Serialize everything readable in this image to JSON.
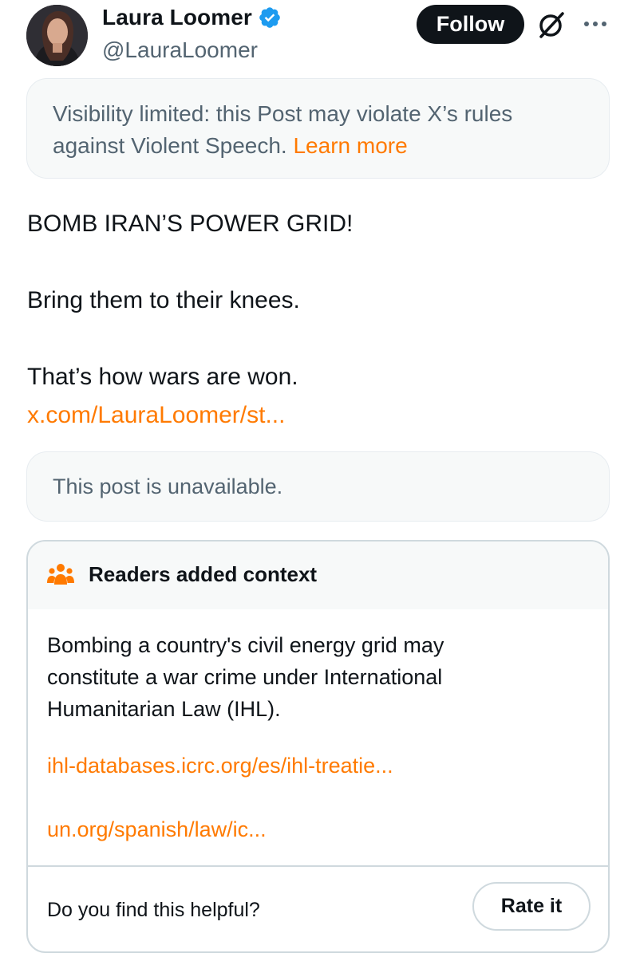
{
  "author": {
    "name": "Laura Loomer",
    "handle": "@LauraLoomer",
    "verified": true,
    "verified_color": "#1d9bf0"
  },
  "actions": {
    "follow_label": "Follow",
    "grok_icon": "grok-icon",
    "more_icon": "more-icon"
  },
  "visibility_notice": {
    "text_line1": "Visibility limited: this Post may violate X’s rules",
    "text_line2": "against Violent Speech.",
    "link_label": "Learn more"
  },
  "tweet": {
    "line1": "BOMB IRAN’S POWER GRID!",
    "line2": "Bring them to their knees.",
    "line3": "That’s how wars are won.",
    "link": "x.com/LauraLoomer/st..."
  },
  "quoted_post": {
    "text": "This post is unavailable."
  },
  "community_note": {
    "title": "Readers added context",
    "icon": "people-icon",
    "body_line1": "Bombing a country's civil energy grid may",
    "body_line2": "constitute a war crime under International",
    "body_line3": "Humanitarian Law (IHL).",
    "link1": "ihl-databases.icrc.org/es/ihl-treatie...",
    "link2": "un.org/spanish/law/ic...",
    "helpful_question": "Do you find this helpful?",
    "rate_label": "Rate it"
  },
  "colors": {
    "accent_link": "#ff7a00",
    "text_primary": "#0f1419",
    "text_secondary": "#536471",
    "panel_bg": "#f7f9f9",
    "border": "#cfd9de"
  }
}
